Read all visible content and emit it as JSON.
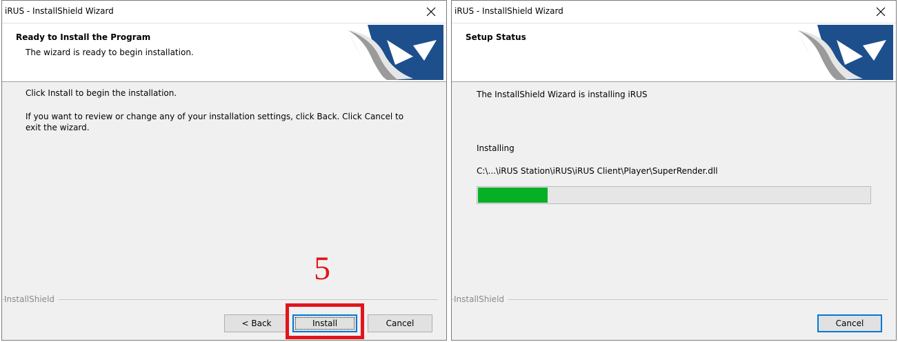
{
  "left_window": {
    "title": "iRUS - InstallShield Wizard",
    "header_title": "Ready to Install the Program",
    "header_subtitle": "The wizard is ready to begin installation.",
    "line1": "Click Install to begin the installation.",
    "line2": "If you want to review or change any of your installation settings, click Back. Click Cancel to",
    "line3": "exit the wizard.",
    "brand": "InstallShield",
    "back_label": "< Back",
    "install_label": "Install",
    "cancel_label": "Cancel"
  },
  "right_window": {
    "title": "iRUS - InstallShield Wizard",
    "header_title": "Setup Status",
    "status": "The InstallShield Wizard is installing iRUS",
    "action": "Installing",
    "file_path": "C:\\...\\iRUS Station\\iRUS\\iRUS Client\\Player\\SuperRender.dll",
    "progress_fraction": 0.18,
    "brand": "InstallShield",
    "cancel_label": "Cancel"
  },
  "annotation": {
    "step_number": "5",
    "color": "#e0161c"
  },
  "colors": {
    "progress": "#06b025",
    "logo_blue": "#1d4f8c",
    "focus_border": "#0078d7"
  },
  "icons": {
    "close": "close-icon",
    "logo": "installshield-logo-icon"
  }
}
